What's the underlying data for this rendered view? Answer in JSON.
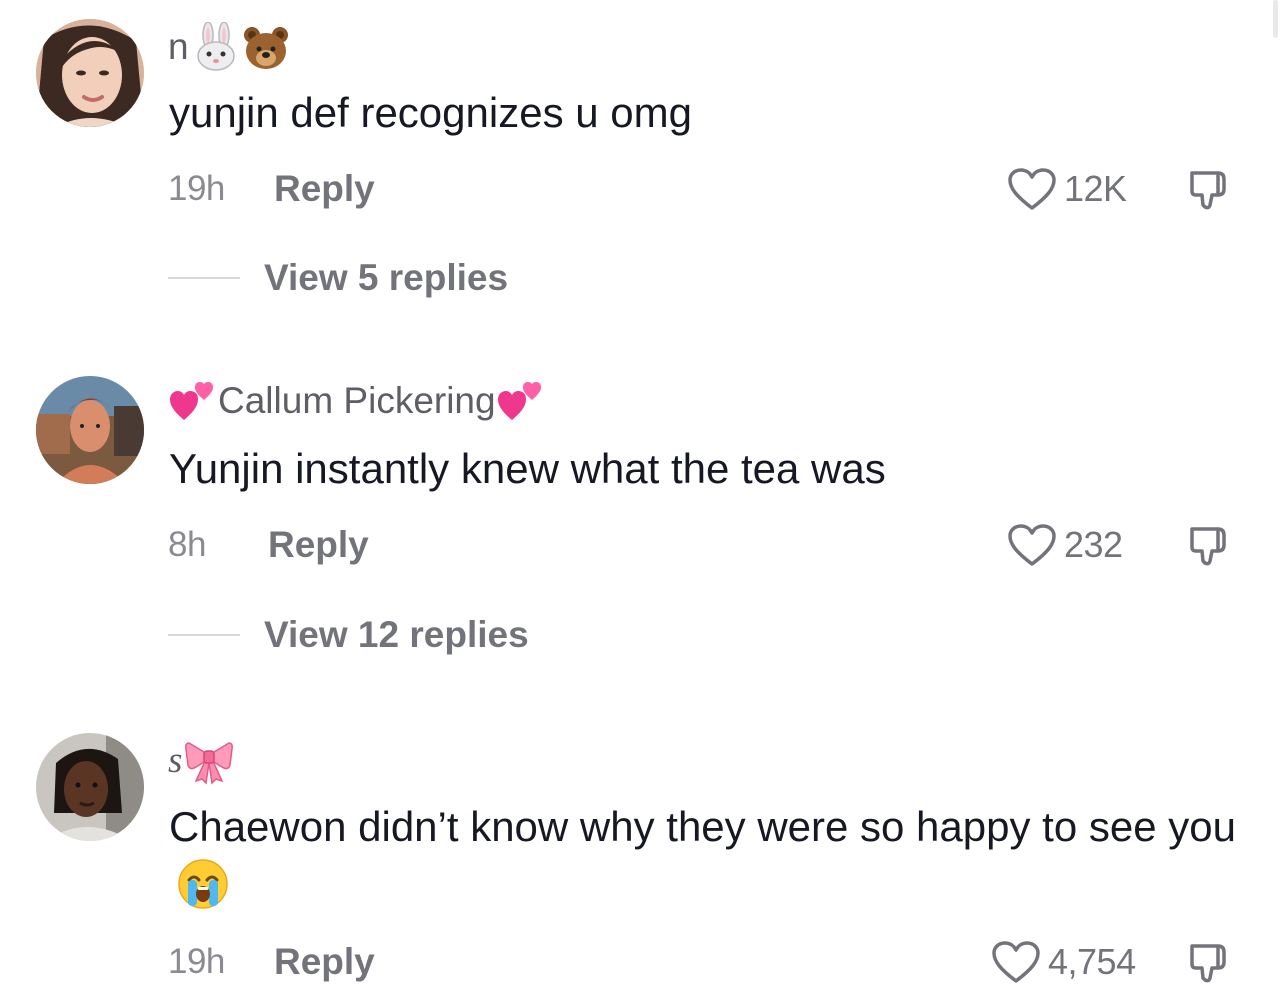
{
  "comments": [
    {
      "username": "n",
      "username_emojis": [
        "rabbit-face",
        "bear-face"
      ],
      "text": "yunjin def recognizes u omg",
      "time": "19h",
      "reply_label": "Reply",
      "likes": "12K",
      "view_replies": "View 5 replies"
    },
    {
      "username": "Callum Pickering",
      "username_emojis": [
        "two-hearts",
        "two-hearts"
      ],
      "text": "Yunjin instantly knew what the tea was",
      "time": "8h",
      "reply_label": "Reply",
      "likes": "232",
      "view_replies": "View 12 replies"
    },
    {
      "username": "s",
      "username_emojis": [
        "ribbon"
      ],
      "text": "Chaewon didn’t know why they were so happy to see you",
      "text_emoji": "loudly-crying-face",
      "time": "19h",
      "reply_label": "Reply",
      "likes": "4,754"
    }
  ],
  "colors": {
    "primary_text": "#161823",
    "secondary_text": "#73747b",
    "timestamp": "#8a8b91",
    "username": "#5d5e66"
  },
  "icons": {
    "like": "heart-outline-icon",
    "dislike": "thumbs-down-outline-icon"
  }
}
